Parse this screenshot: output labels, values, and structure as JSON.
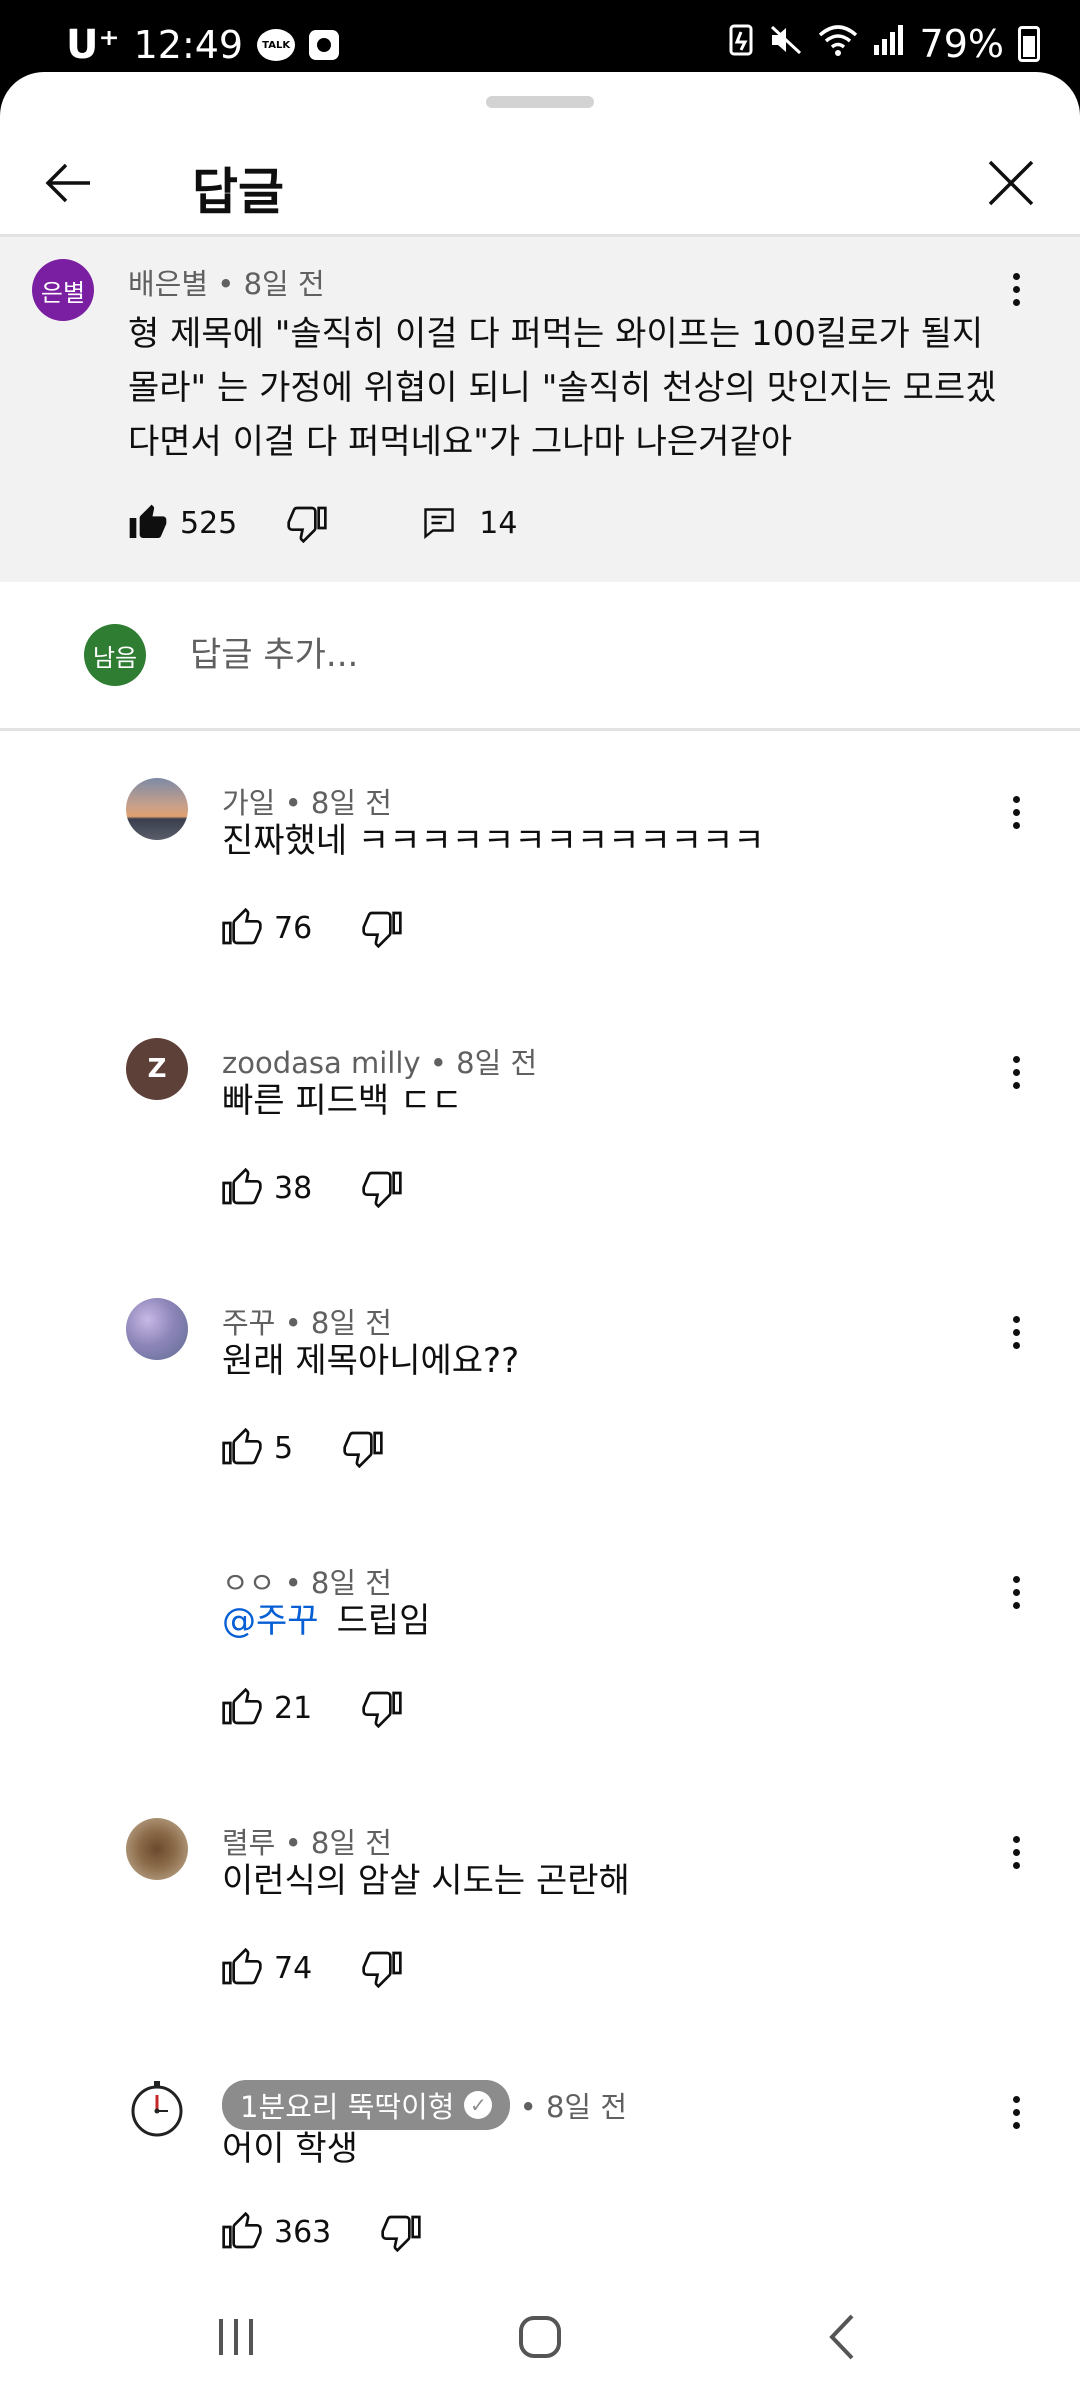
{
  "status_bar": {
    "carrier": "U⁺",
    "time": "12:49",
    "talk_icon_label": "TALK",
    "battery": "79%",
    "icons": [
      "talk-icon",
      "record-icon",
      "battery-saver-icon",
      "mute-icon",
      "wifi-icon",
      "signal-icon",
      "battery-icon"
    ]
  },
  "header": {
    "title": "답글"
  },
  "parent_comment": {
    "avatar_text": "은별",
    "avatar_color": "#7b1fa2",
    "author": "배은별",
    "time": "8일 전",
    "text": "형 제목에 \"솔직히 이걸 다 퍼먹는 와이프는 100킬로가 될지몰라\" 는 가정에 위협이 되니 \"솔직히 천상의 맛인지는 모르겠다면서 이걸 다 퍼먹네요\"가 그나마 나은거같아",
    "likes": "525",
    "reply_count": "14"
  },
  "add_reply": {
    "avatar_text": "남음",
    "avatar_color": "#2e7d32",
    "placeholder": "답글 추가..."
  },
  "replies": [
    {
      "author": "가일",
      "time": "8일 전",
      "text": "진짜했네 ㅋㅋㅋㅋㅋㅋㅋㅋㅋㅋㅋㅋㅋ",
      "likes": "76"
    },
    {
      "author": "zoodasa milly",
      "time": "8일 전",
      "text": "빠른 피드백 ㄷㄷ",
      "likes": "38",
      "avatar_text": "Z",
      "avatar_color": "#5d4037"
    },
    {
      "author": "주꾸",
      "time": "8일 전",
      "text": "원래 제목아니에요??",
      "likes": "5"
    },
    {
      "author": "ㅇㅇ",
      "time": "8일 전",
      "mention": "@주꾸",
      "text": "드립임",
      "likes": "21"
    },
    {
      "author": "렬루",
      "time": "8일 전",
      "text": "이런식의 암살 시도는 곤란해",
      "likes": "74"
    },
    {
      "author": "1분요리 뚝딱이형",
      "time": "8일 전",
      "text": "어이 학생",
      "likes": "363",
      "creator": true
    }
  ],
  "separator": "•",
  "colors": {
    "sheet_bg": "#ffffff",
    "parent_bg": "#f2f2f2",
    "secondary_text": "#606060",
    "mention": "#065fd4",
    "creator_badge": "#8c8c8c"
  }
}
